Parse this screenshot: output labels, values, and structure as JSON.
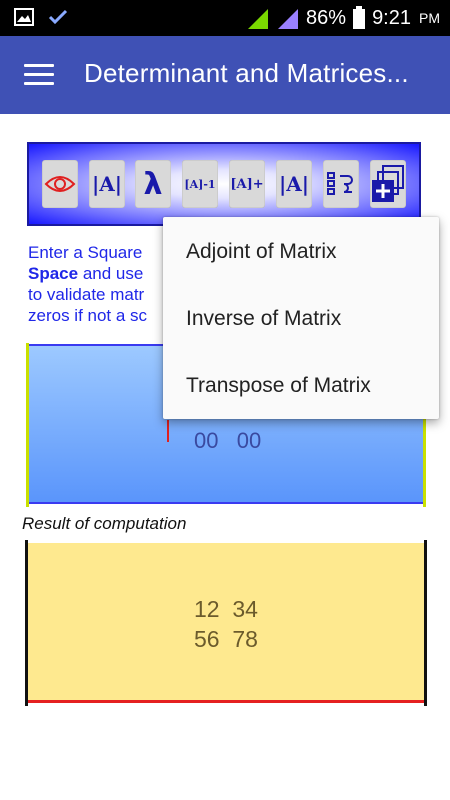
{
  "status_bar": {
    "battery_percent": "86%",
    "time": "9:21",
    "ampm": "PM"
  },
  "app_bar": {
    "title": "Determinant and Matrices..."
  },
  "toolbar": {
    "buttons": [
      {
        "icon": "eye-icon",
        "label": ""
      },
      {
        "icon": "determinant-icon",
        "label": "|A|"
      },
      {
        "icon": "lambda-icon",
        "label": "λ"
      },
      {
        "icon": "inverse-icon",
        "label": "[A]-1"
      },
      {
        "icon": "adjoint-icon",
        "label": "[A]+"
      },
      {
        "icon": "abs-matrix-icon",
        "label": "|A|"
      },
      {
        "icon": "list-icon",
        "label": ""
      },
      {
        "icon": "add-matrix-icon",
        "label": ""
      }
    ]
  },
  "instructions": {
    "line1": "Enter a Square",
    "line2_bold": "Space",
    "line2_rest": " and use",
    "line3": "to validate matr",
    "line4": "zeros if not a sc"
  },
  "input_matrix": {
    "visible_line": "00   00"
  },
  "result": {
    "label": "Result of computation",
    "line1": "12  34",
    "line2": "56  78"
  },
  "menu": {
    "items": [
      "Adjoint of Matrix",
      "Inverse of Matrix",
      "Transpose of Matrix"
    ]
  },
  "colors": {
    "app_bar": "#3f51b5",
    "instructions_text": "#1f27e8",
    "result_background": "#fee98f",
    "input_background": "#5a95fb"
  }
}
